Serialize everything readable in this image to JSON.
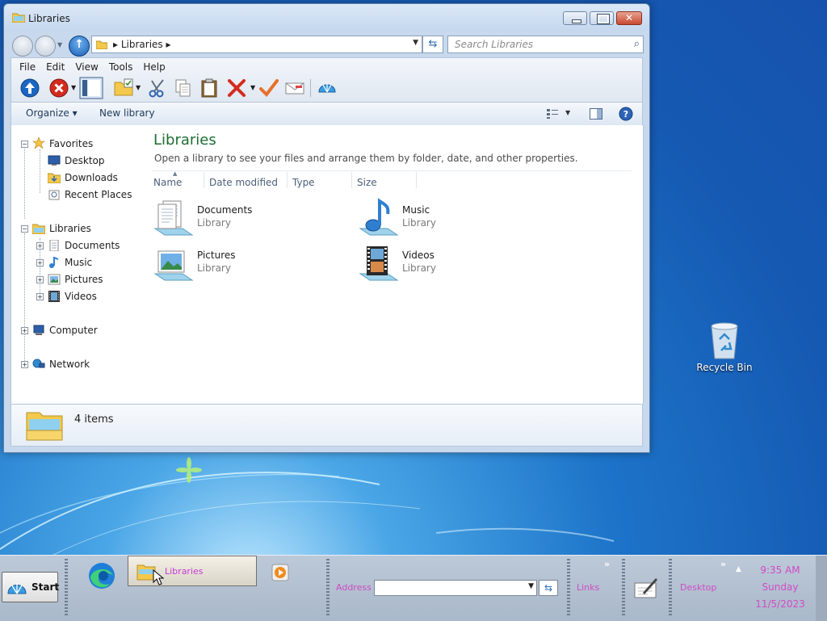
{
  "window": {
    "title": "Libraries",
    "breadcrumb": "Libraries",
    "search_placeholder": "Search Libraries",
    "menu": [
      "File",
      "Edit",
      "View",
      "Tools",
      "Help"
    ],
    "commands": {
      "organize": "Organize ▾",
      "new_library": "New library"
    },
    "nav_tree": {
      "favorites": {
        "label": "Favorites",
        "items": [
          "Desktop",
          "Downloads",
          "Recent Places"
        ]
      },
      "libraries": {
        "label": "Libraries",
        "items": [
          "Documents",
          "Music",
          "Pictures",
          "Videos"
        ]
      },
      "computer": "Computer",
      "network": "Network"
    },
    "content": {
      "heading": "Libraries",
      "subtitle": "Open a library to see your files and arrange them by folder, date, and other properties.",
      "columns": [
        "Name",
        "Date modified",
        "Type",
        "Size"
      ],
      "items": [
        {
          "name": "Documents",
          "type": "Library"
        },
        {
          "name": "Music",
          "type": "Library"
        },
        {
          "name": "Pictures",
          "type": "Library"
        },
        {
          "name": "Videos",
          "type": "Library"
        }
      ]
    },
    "status": {
      "item_count": "4 items"
    }
  },
  "desktop": {
    "recycle_bin": "Recycle Bin"
  },
  "taskbar": {
    "start": "Start",
    "task_libraries": "Libraries",
    "address_label": "Address",
    "links_label": "Links",
    "desktop_label": "Desktop",
    "clock": {
      "time": "9:35 AM",
      "day": "Sunday",
      "date": "11/5/2023"
    }
  },
  "colors": {
    "heading": "#1e6e32",
    "taskbar_text": "#d14bc4",
    "close_button": "#c84a32"
  }
}
